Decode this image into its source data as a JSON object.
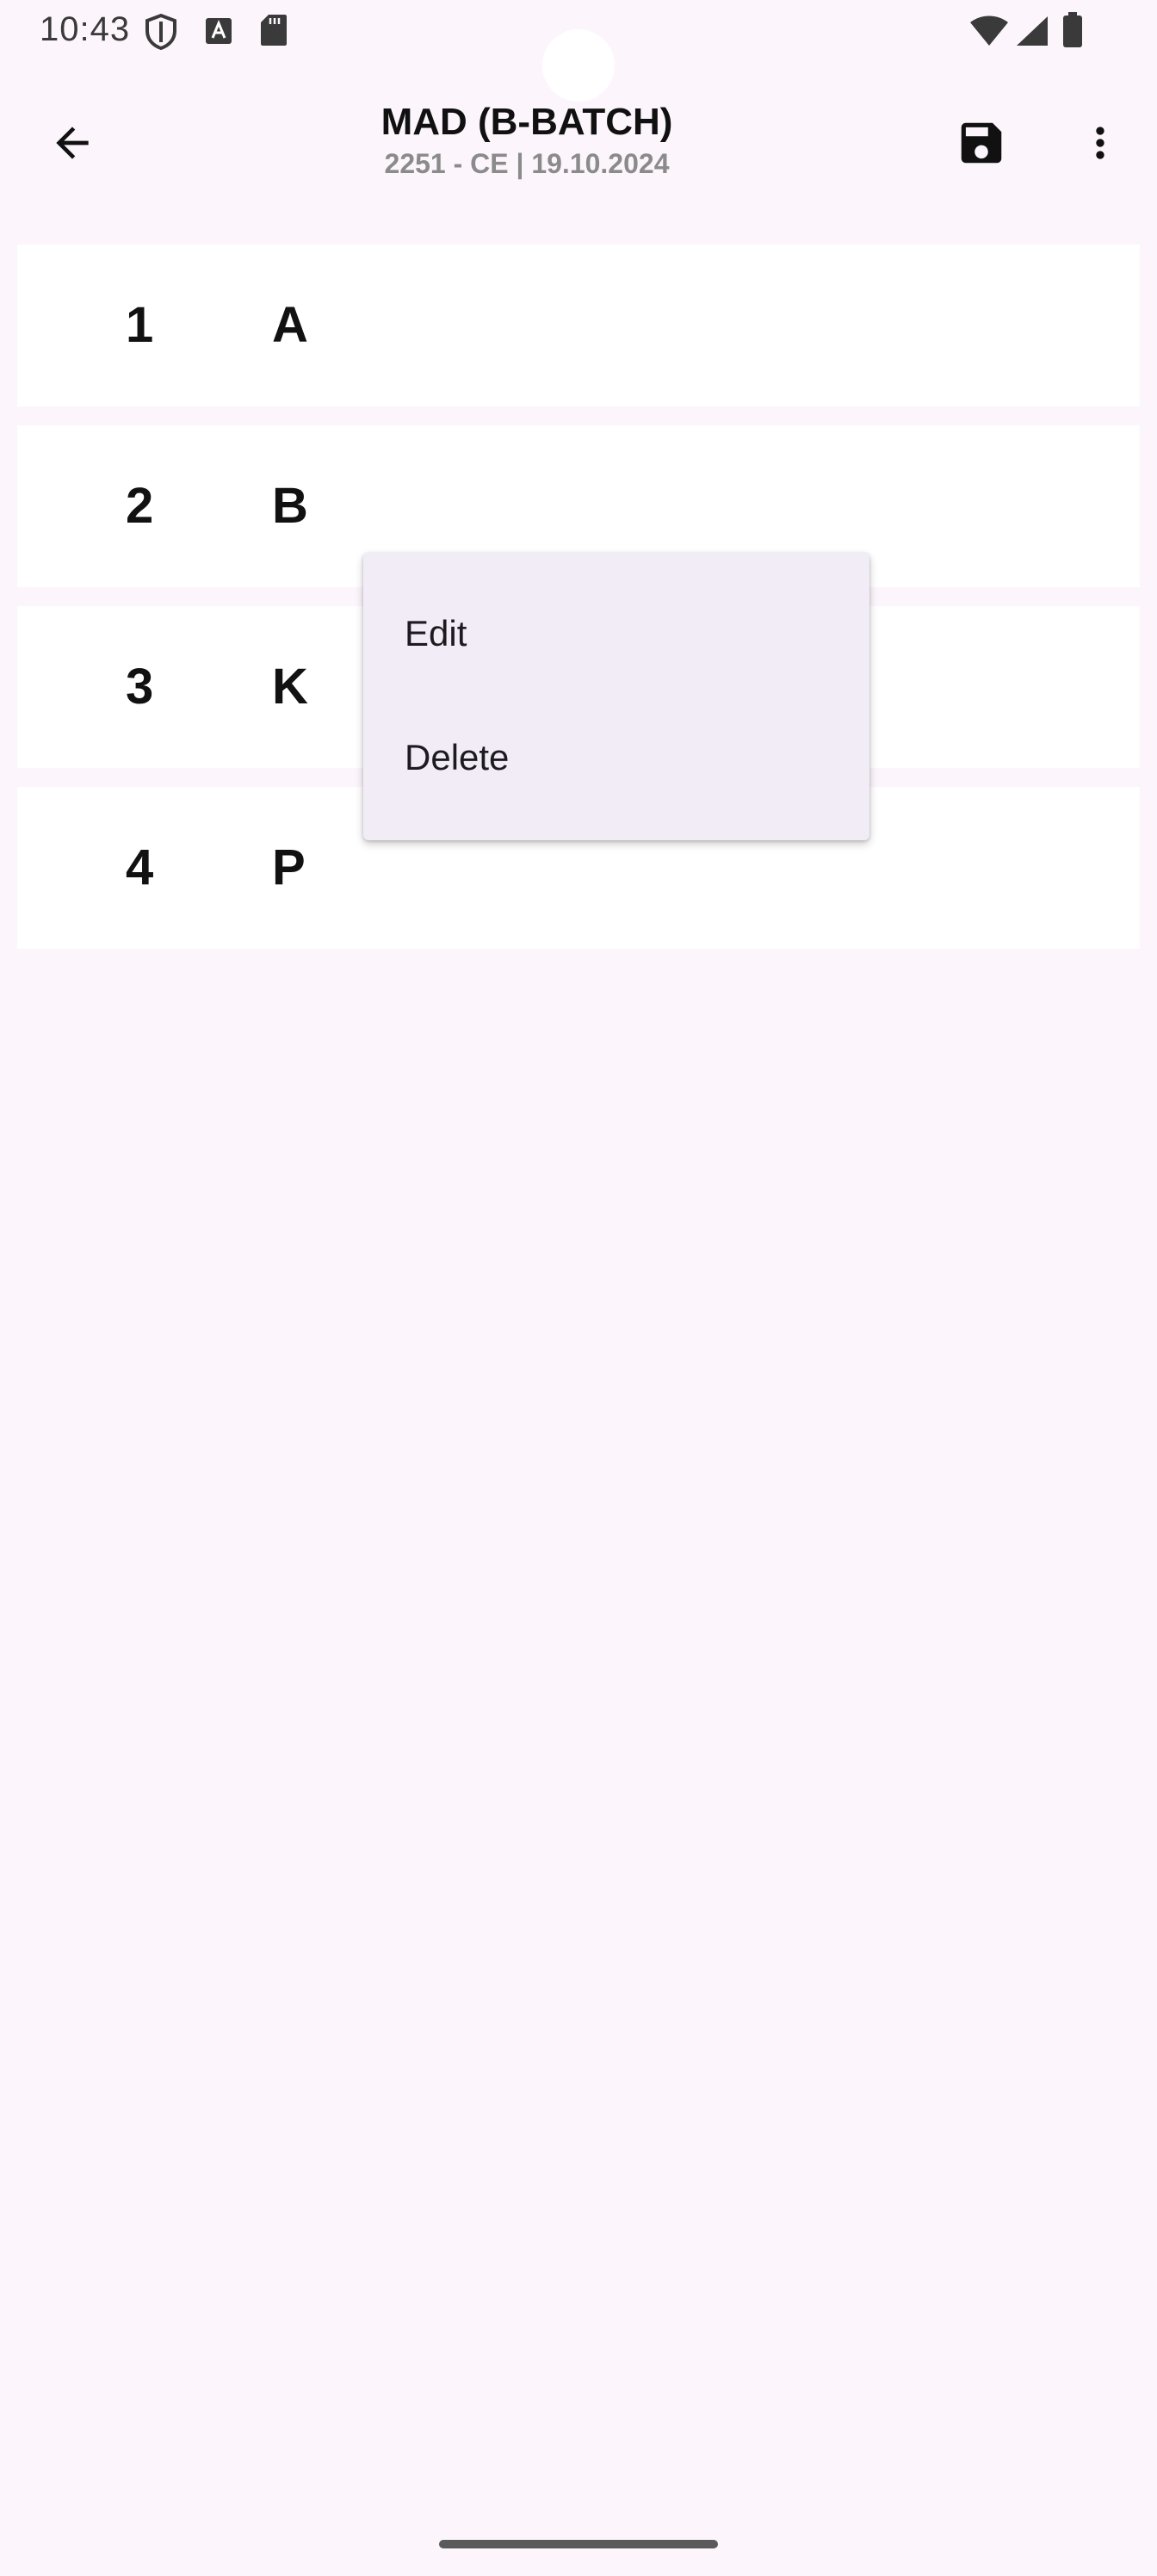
{
  "status_bar": {
    "time": "10:43"
  },
  "app_bar": {
    "title": "MAD (B-BATCH)",
    "subtitle": "2251 - CE | 19.10.2024"
  },
  "list": [
    {
      "number": "1",
      "code": "A"
    },
    {
      "number": "2",
      "code": "B"
    },
    {
      "number": "3",
      "code": "K"
    },
    {
      "number": "4",
      "code": "P"
    }
  ],
  "popup_menu": {
    "items": [
      "Edit",
      "Delete"
    ]
  },
  "colors": {
    "background": "#fcf6fc",
    "menu_background": "#f1ecf6",
    "card": "#ffffff",
    "text": "#111111",
    "subtitle": "#8b8b8b"
  },
  "icons": [
    "back-arrow-icon",
    "save-icon",
    "more-vert-icon",
    "shield-icon",
    "font-icon",
    "sd-card-icon",
    "wifi-icon",
    "signal-icon",
    "battery-icon"
  ]
}
